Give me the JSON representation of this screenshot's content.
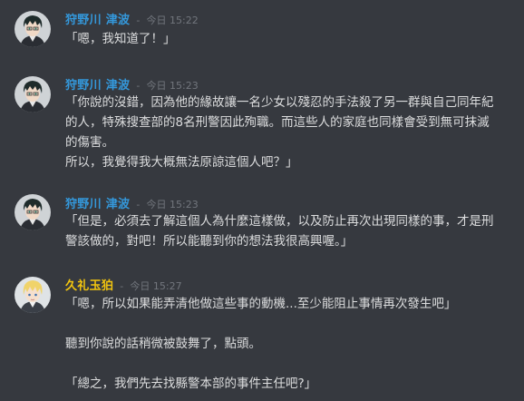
{
  "messages": [
    {
      "author": "狩野川 津波",
      "author_color": "#3498db",
      "separator": "-",
      "timestamp": "今日 15:22",
      "avatar_icon": "dark-haired-boy-avatar",
      "lines": [
        "「嗯，我知道了！」"
      ]
    },
    {
      "author": "狩野川 津波",
      "author_color": "#3498db",
      "separator": "-",
      "timestamp": "今日 15:23",
      "avatar_icon": "dark-haired-boy-avatar",
      "lines": [
        "「你說的沒錯，因為他的緣故讓一名少女以殘忍的手法殺了另一群與自己同年紀",
        "的人，特殊搜查部的8名刑警因此殉職。而這些人的家庭也同樣會受到無可抹滅",
        "的傷害。",
        "所以，我覺得我大概無法原諒這個人吧？」"
      ]
    },
    {
      "author": "狩野川 津波",
      "author_color": "#3498db",
      "separator": "-",
      "timestamp": "今日 15:23",
      "avatar_icon": "dark-haired-boy-avatar",
      "lines": [
        "「但是，必須去了解這個人為什麼這樣做，以及防止再次出現同樣的事，才是刑",
        "警該做的，對吧！所以能聽到你的想法我很高興喔。」"
      ]
    },
    {
      "author": "久礼玉狛",
      "author_color": "#f1c40f",
      "separator": "-",
      "timestamp": "今日 15:27",
      "avatar_icon": "blond-boy-avatar",
      "lines": [
        "「嗯，所以如果能弄清他做這些事的動機...至少能阻止事情再次發生吧」",
        "",
        "聽到你說的話稍微被鼓舞了，點頭。",
        "",
        "「總之，我們先去找縣警本部的事件主任吧?」"
      ]
    }
  ]
}
